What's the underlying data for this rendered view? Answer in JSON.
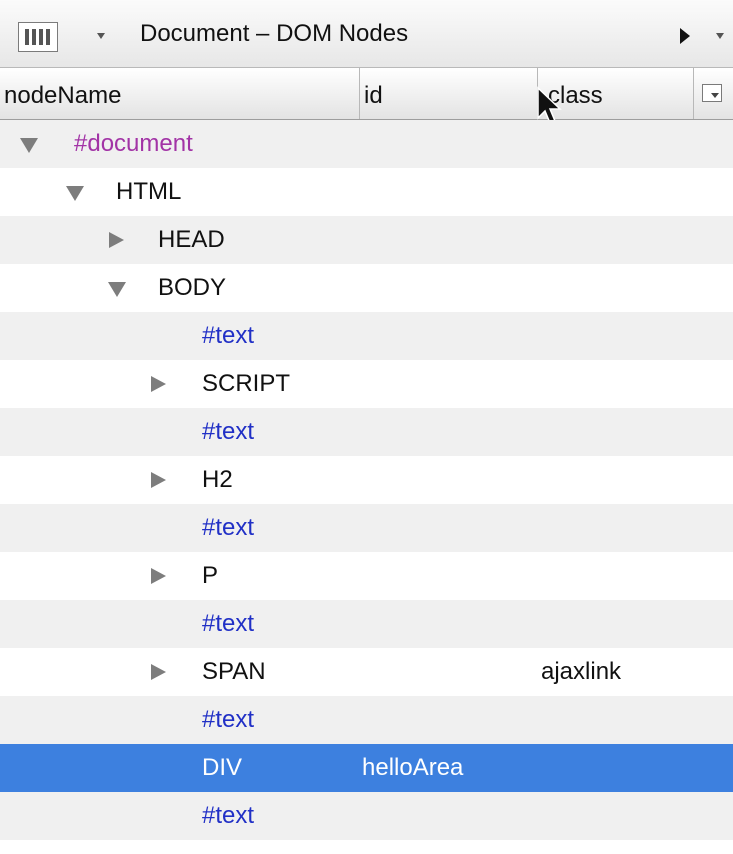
{
  "panel": {
    "title": "Document – DOM Nodes"
  },
  "columns": {
    "node_name": "nodeName",
    "id": "id",
    "class": "class"
  },
  "rows": [
    {
      "name": "#document",
      "id": "",
      "class": ""
    },
    {
      "name": "HTML",
      "id": "",
      "class": ""
    },
    {
      "name": "HEAD",
      "id": "",
      "class": ""
    },
    {
      "name": "BODY",
      "id": "",
      "class": ""
    },
    {
      "name": "#text",
      "id": "",
      "class": ""
    },
    {
      "name": "SCRIPT",
      "id": "",
      "class": ""
    },
    {
      "name": "#text",
      "id": "",
      "class": ""
    },
    {
      "name": "H2",
      "id": "",
      "class": ""
    },
    {
      "name": "#text",
      "id": "",
      "class": ""
    },
    {
      "name": "P",
      "id": "",
      "class": ""
    },
    {
      "name": "#text",
      "id": "",
      "class": ""
    },
    {
      "name": "SPAN",
      "id": "",
      "class": "ajaxlink"
    },
    {
      "name": "#text",
      "id": "",
      "class": ""
    },
    {
      "name": "DIV",
      "id": "helloArea",
      "class": ""
    },
    {
      "name": "#text",
      "id": "",
      "class": ""
    }
  ],
  "colors": {
    "selection": "#3d80df",
    "document_node": "#a233a6",
    "text_node": "#2130c6",
    "stripe": "#f0f0f0"
  }
}
